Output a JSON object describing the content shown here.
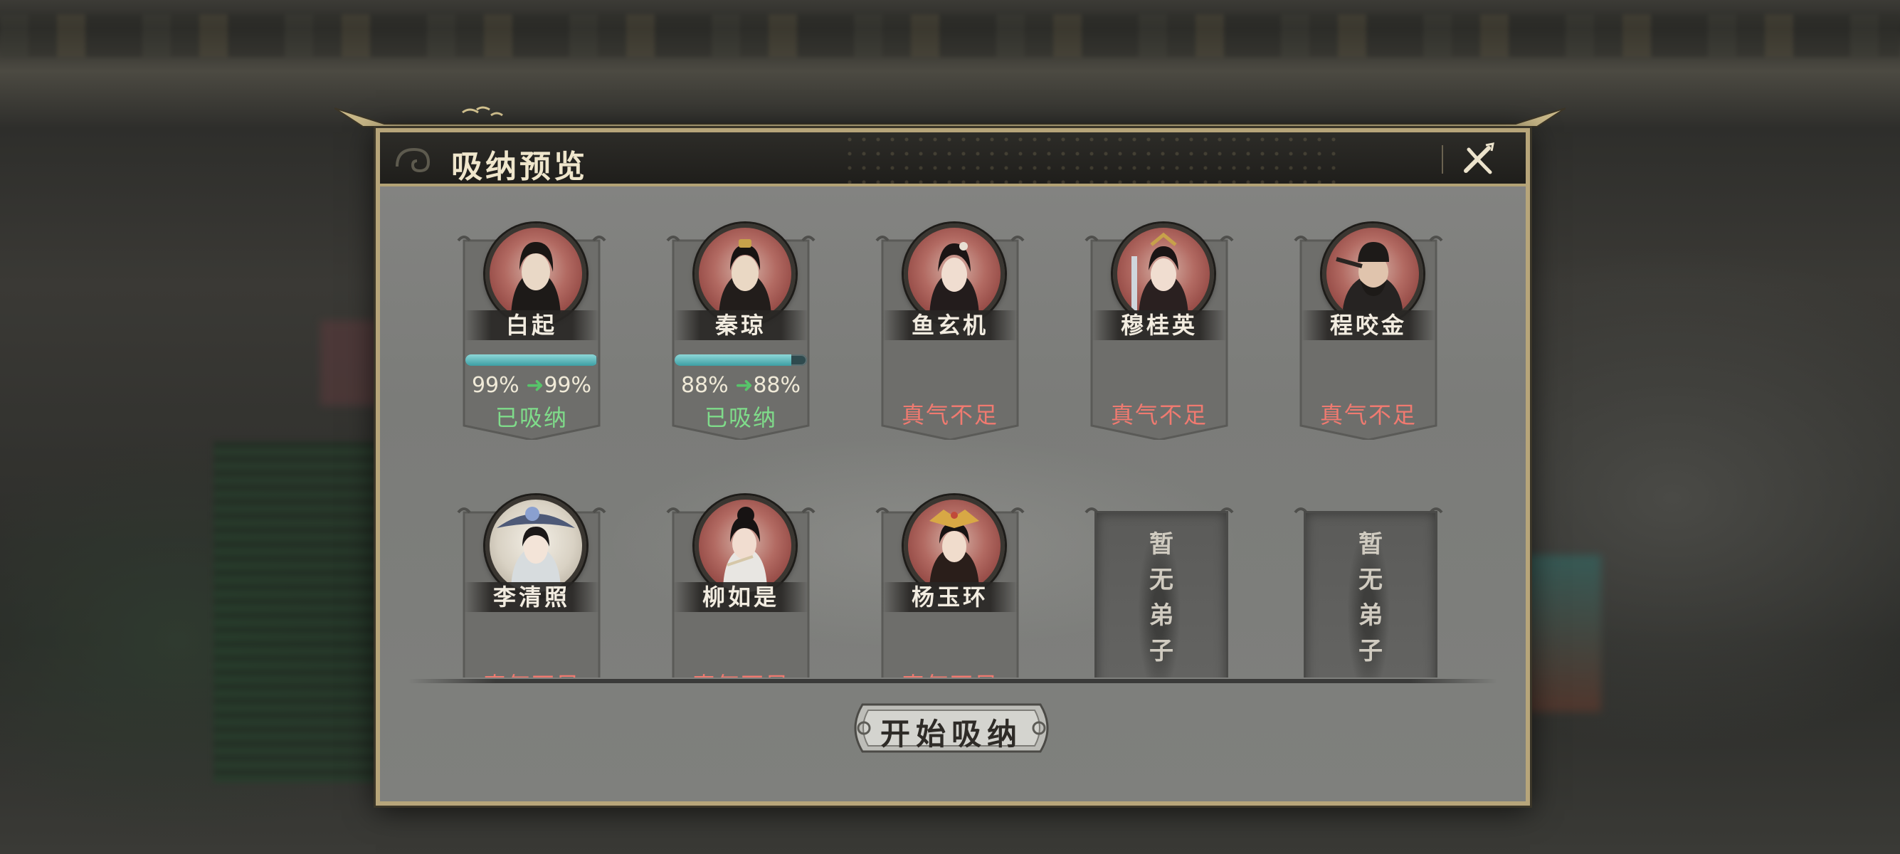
{
  "window": {
    "title": "吸纳预览",
    "close_icon": "close-icon"
  },
  "disciples": [
    {
      "name": "白起",
      "bar_percent": 99,
      "from": "99%",
      "to": "99%",
      "status": "已吸纳",
      "state": "absorbed"
    },
    {
      "name": "秦琼",
      "bar_percent": 88,
      "from": "88%",
      "to": "88%",
      "status": "已吸纳",
      "state": "absorbed"
    },
    {
      "name": "鱼玄机",
      "status": "真气不足",
      "state": "insufficient"
    },
    {
      "name": "穆桂英",
      "status": "真气不足",
      "state": "insufficient"
    },
    {
      "name": "程咬金",
      "status": "真气不足",
      "state": "insufficient"
    },
    {
      "name": "李清照",
      "status": "真气不足",
      "state": "insufficient"
    },
    {
      "name": "柳如是",
      "status": "真气不足",
      "state": "insufficient"
    },
    {
      "name": "杨玉环",
      "status": "真气不足",
      "state": "insufficient"
    }
  ],
  "empty_slots": [
    {
      "text": "暂无弟子"
    },
    {
      "text": "暂无弟子"
    }
  ],
  "footer": {
    "start_button": "开始吸纳"
  },
  "colors": {
    "absorbed_text": "#7fdc8a",
    "insufficient_text": "#f07a70",
    "frame_gold": "#b7a57a",
    "bar_fill": "#3e9fa4"
  }
}
